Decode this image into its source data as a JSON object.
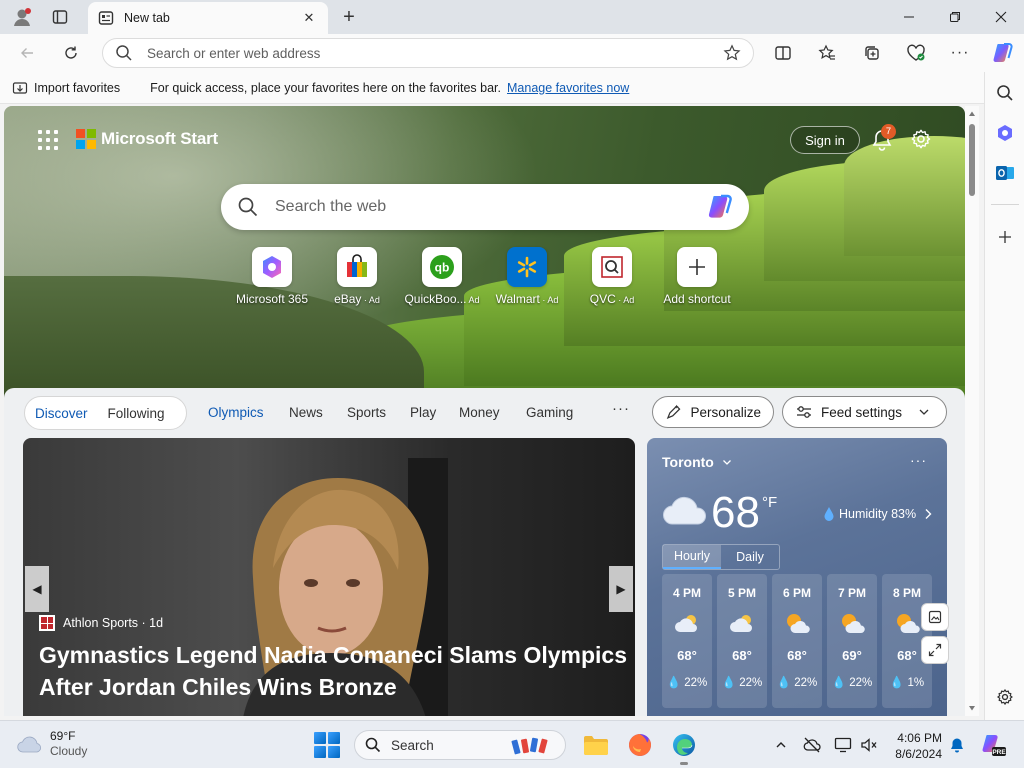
{
  "browser": {
    "tab_title": "New tab",
    "address_placeholder": "Search or enter web address"
  },
  "favorites_bar": {
    "import_label": "Import favorites",
    "message": "For quick access, place your favorites here on the favorites bar.",
    "manage_link": "Manage favorites now"
  },
  "page": {
    "brand": "Microsoft Start",
    "sign_in": "Sign in",
    "notification_count": "7",
    "search_placeholder": "Search the web",
    "shortcuts": [
      {
        "label": "Microsoft 365",
        "ad": ""
      },
      {
        "label": "eBay",
        "ad": " · Ad"
      },
      {
        "label": "QuickBoo...",
        "ad": " Ad"
      },
      {
        "label": "Walmart",
        "ad": " · Ad"
      },
      {
        "label": "QVC",
        "ad": " · Ad"
      },
      {
        "label": "Add shortcut",
        "ad": ""
      }
    ],
    "feed_tabs": {
      "discover": "Discover",
      "following": "Following",
      "links": [
        "Olympics",
        "News",
        "Sports",
        "Play",
        "Money",
        "Gaming"
      ],
      "more": "···",
      "personalize": "Personalize",
      "feed_settings": "Feed settings"
    },
    "news": {
      "source": "Athlon Sports · 1d",
      "title": "Gymnastics Legend Nadia Comaneci Slams Olympics After Jordan Chiles Wins Bronze"
    },
    "weather": {
      "city": "Toronto",
      "more": "···",
      "temp": "68",
      "unit": "°F",
      "humidity": "Humidity 83%",
      "tab_hourly": "Hourly",
      "tab_daily": "Daily",
      "hours": [
        {
          "time": "4 PM",
          "temp": "68°",
          "rain": "22%",
          "icon": "partly-cloudy-icon"
        },
        {
          "time": "5 PM",
          "temp": "68°",
          "rain": "22%",
          "icon": "partly-cloudy-icon"
        },
        {
          "time": "6 PM",
          "temp": "68°",
          "rain": "22%",
          "icon": "sun-cloud-icon"
        },
        {
          "time": "7 PM",
          "temp": "69°",
          "rain": "22%",
          "icon": "sun-cloud-icon"
        },
        {
          "time": "8 PM",
          "temp": "68°",
          "rain": "1%",
          "icon": "sun-cloud-icon"
        }
      ]
    }
  },
  "taskbar": {
    "weather_temp": "69°F",
    "weather_cond": "Cloudy",
    "search_placeholder": "Search",
    "time": "4:06 PM",
    "date": "8/6/2024"
  },
  "colors": {
    "accent": "#0f5ab4",
    "badge": "#e25b27",
    "weather_bg": "#5c7399"
  }
}
